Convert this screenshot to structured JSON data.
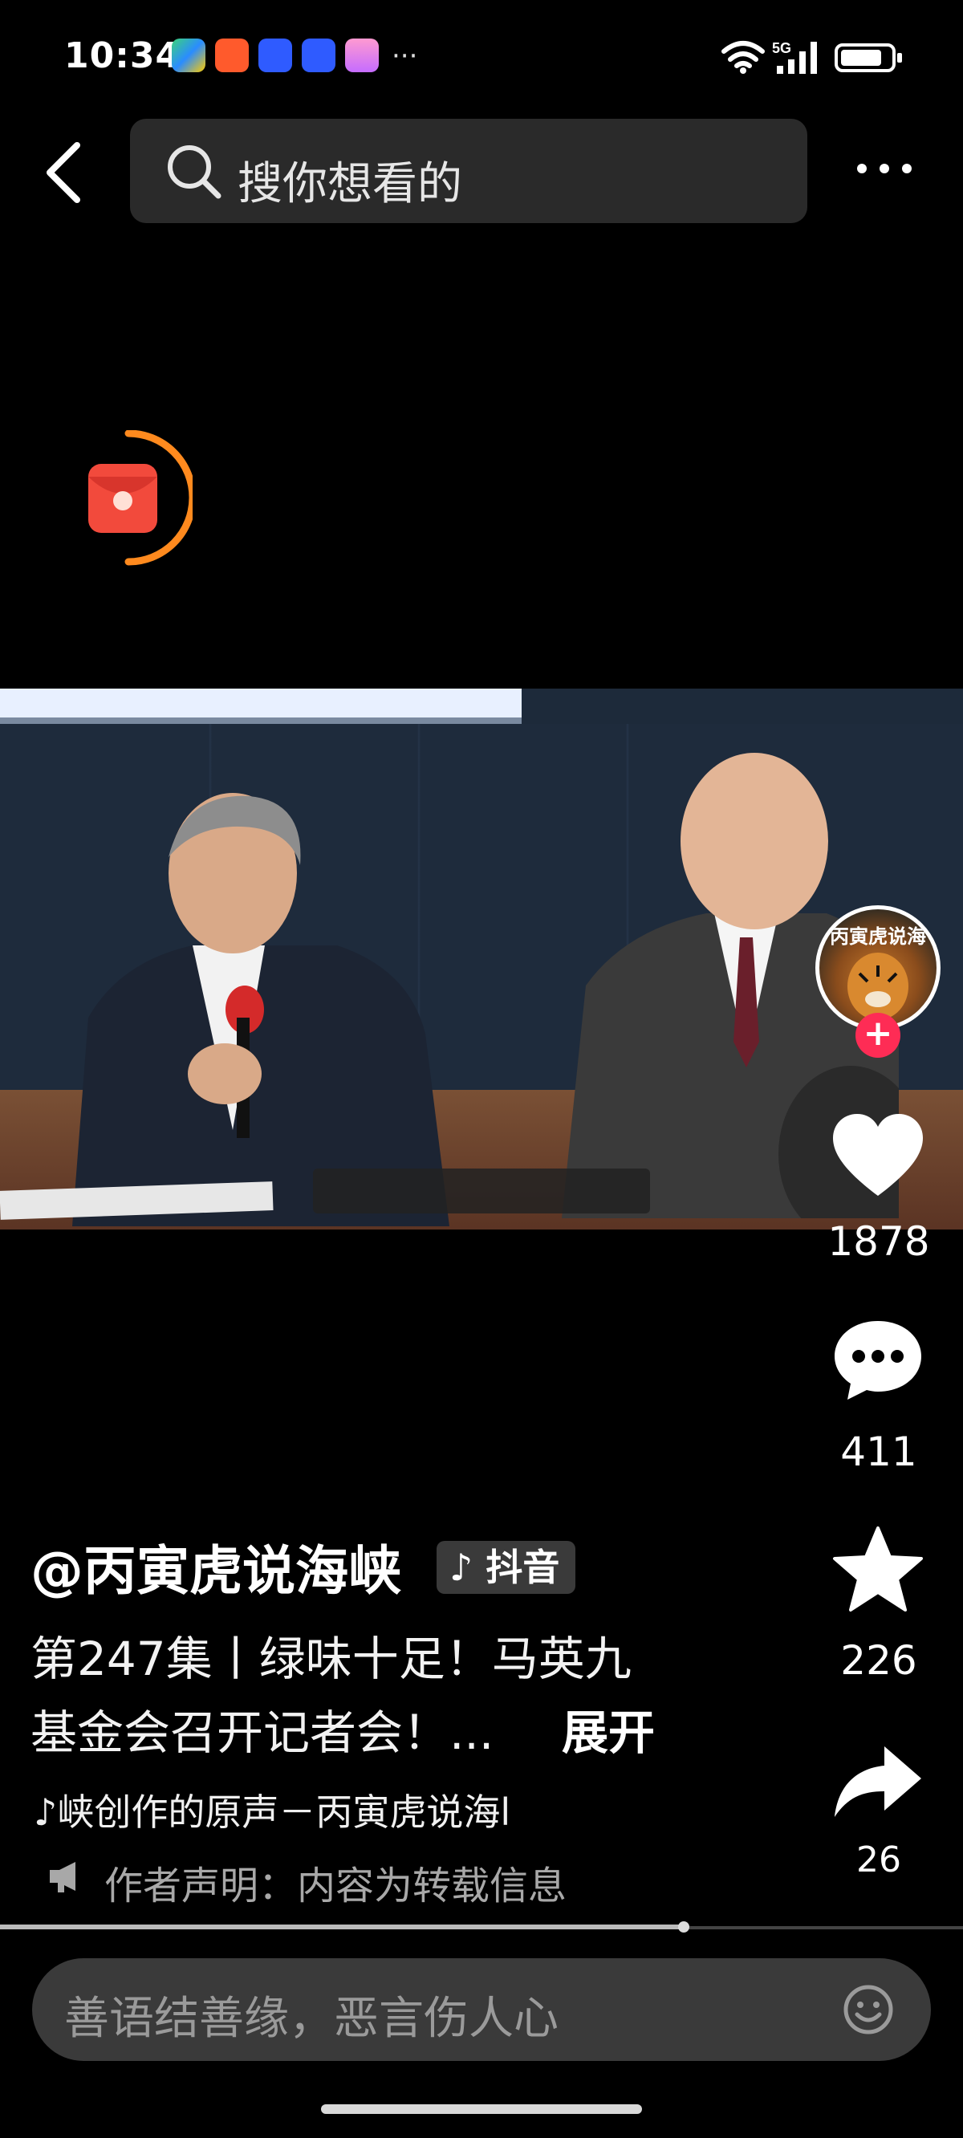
{
  "status_bar": {
    "time": "10:34",
    "more": "···",
    "network": "5G"
  },
  "header": {
    "search_placeholder": "搜你想看的"
  },
  "video": {
    "subtitle_text": ""
  },
  "actions": {
    "likes": "1878",
    "comments": "411",
    "favorites": "226",
    "shares": "26"
  },
  "author": {
    "name": "@丙寅虎说海峡",
    "avatar_text": "丙寅虎说海",
    "platform_tag": "抖音"
  },
  "caption": {
    "line1": "第247集丨绿味十足！马英九",
    "line2": "基金会召开记者会！...",
    "expand": "展开"
  },
  "music": {
    "text": "♪峡创作的原声－丙寅虎说海l"
  },
  "disclaimer": {
    "text": "作者声明：内容为转载信息"
  },
  "comment_input": {
    "placeholder": "善语结善缘，恶言伤人心"
  },
  "colors": {
    "accent_red": "#fe2c55",
    "search_bg": "#2a2a2a",
    "input_bg": "#3a3a3a"
  },
  "playback": {
    "progress": 0.71
  }
}
